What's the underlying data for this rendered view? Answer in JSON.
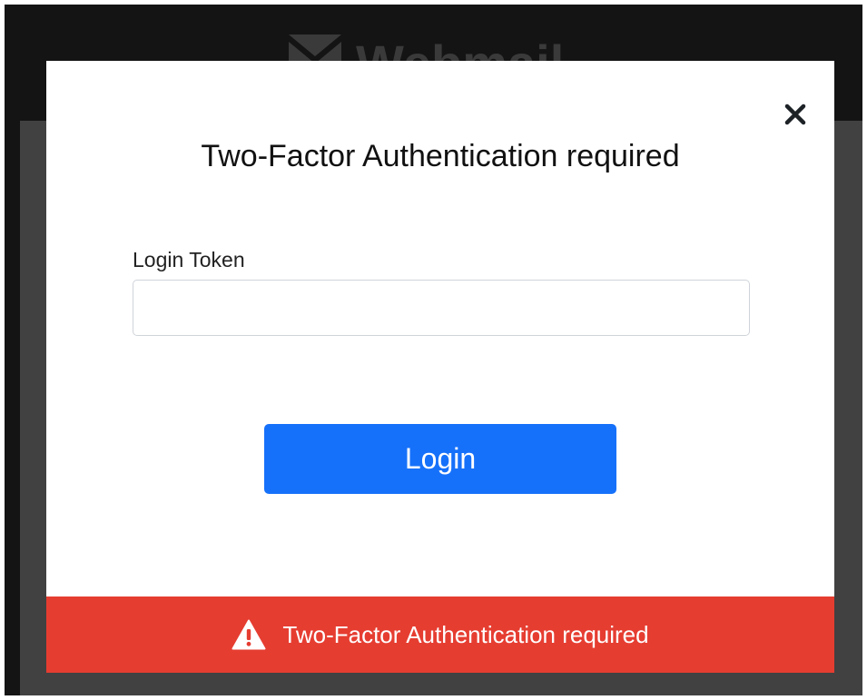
{
  "app": {
    "brand_name": "Webmail",
    "brand_icon": "envelope-icon"
  },
  "dialog": {
    "title": "Two-Factor Authentication required",
    "close_icon": "close-icon",
    "token_field": {
      "label": "Login Token",
      "value": "",
      "placeholder": ""
    },
    "login_button": {
      "label": "Login",
      "color": "#1671fa"
    }
  },
  "error_banner": {
    "message": "Two-Factor Authentication required",
    "icon": "warning-icon",
    "color": "#e63d31"
  }
}
